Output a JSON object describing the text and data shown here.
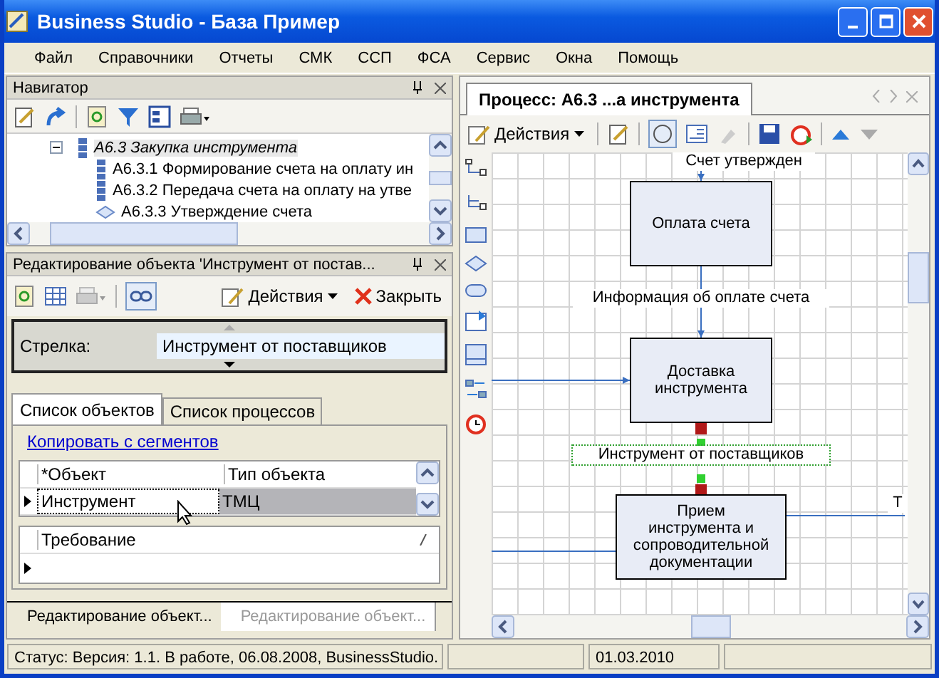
{
  "window": {
    "title": "Business Studio - База Пример"
  },
  "menu": [
    "Файл",
    "Справочники",
    "Отчеты",
    "СМК",
    "ССП",
    "ФСА",
    "Сервис",
    "Окна",
    "Помощь"
  ],
  "navigator": {
    "title": "Навигатор",
    "tree": [
      {
        "label": "А6.3 Закупка инструмента",
        "kind": "process",
        "selected": true,
        "expanded": true,
        "children": [
          {
            "label": "А6.3.1 Формирование счета на оплату ин",
            "kind": "process",
            "selected": false
          },
          {
            "label": "А6.3.2 Передача счета на оплату на утве",
            "kind": "process",
            "selected": false
          },
          {
            "label": "А6.3.3 Утверждение счета",
            "kind": "decision",
            "selected": false
          }
        ]
      }
    ]
  },
  "editor": {
    "title": "Редактирование объекта 'Инструмент от постав...",
    "actions": "Действия",
    "close": "Закрыть",
    "field_label": "Стрелка:",
    "field_value": "Инструмент от поставщиков",
    "tabs": [
      {
        "label": "Список объектов",
        "selected": true
      },
      {
        "label": "Список процессов",
        "selected": false
      }
    ],
    "link": "Копировать с сегментов",
    "grid": {
      "columns": [
        "*Объект",
        "Тип объекта"
      ],
      "rows": [
        [
          "Инструмент",
          "ТМЦ"
        ]
      ]
    },
    "grid2": {
      "columns": [
        "Требование"
      ]
    }
  },
  "bottom_tabs": [
    {
      "label": "Редактирование объект...",
      "selected": true
    },
    {
      "label": "Редактирование объект...",
      "selected": false
    }
  ],
  "document": {
    "tab": "Процесс: А6.3 ...а инструмента",
    "actions": "Действия",
    "nodes": [
      {
        "label": "Оплата счета"
      },
      {
        "label": "Доставка инструмента"
      },
      {
        "label": "Прием инструмента и сопроводительной документации"
      }
    ],
    "arrows": [
      {
        "label": "Счет утвержден",
        "selected": false
      },
      {
        "label": "Информация об оплате счета",
        "selected": false
      },
      {
        "label": "Инструмент от поставщиков",
        "selected": true
      },
      {
        "label": "Т",
        "selected": false
      }
    ]
  },
  "status_bar": {
    "text": "Статус: Версия: 1.1. В работе, 06.08.2008, BusinessStudio.",
    "date": "01.03.2010"
  }
}
